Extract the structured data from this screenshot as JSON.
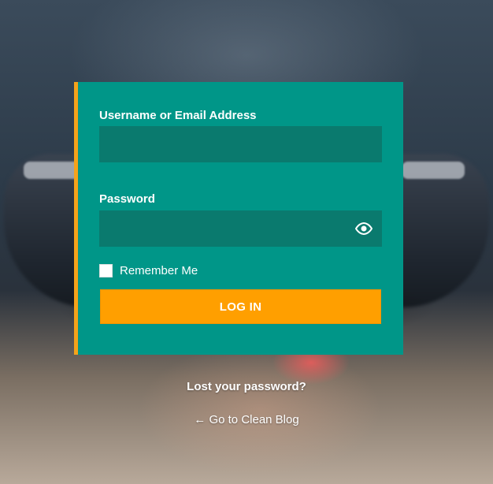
{
  "login_form": {
    "username_label": "Username or Email Address",
    "username_value": "",
    "password_label": "Password",
    "password_value": "",
    "remember_label": "Remember Me",
    "remember_checked": false,
    "submit_label": "LOG IN"
  },
  "links": {
    "lost_password": "Lost your password?",
    "back_to_site": "← Go to Clean Blog"
  },
  "icons": {
    "show_password": "eye-icon"
  },
  "colors": {
    "card_background": "#009688",
    "input_background": "#0a7a6e",
    "accent": "#f5a31a",
    "button": "#ff9f00",
    "text": "#ffffff"
  }
}
